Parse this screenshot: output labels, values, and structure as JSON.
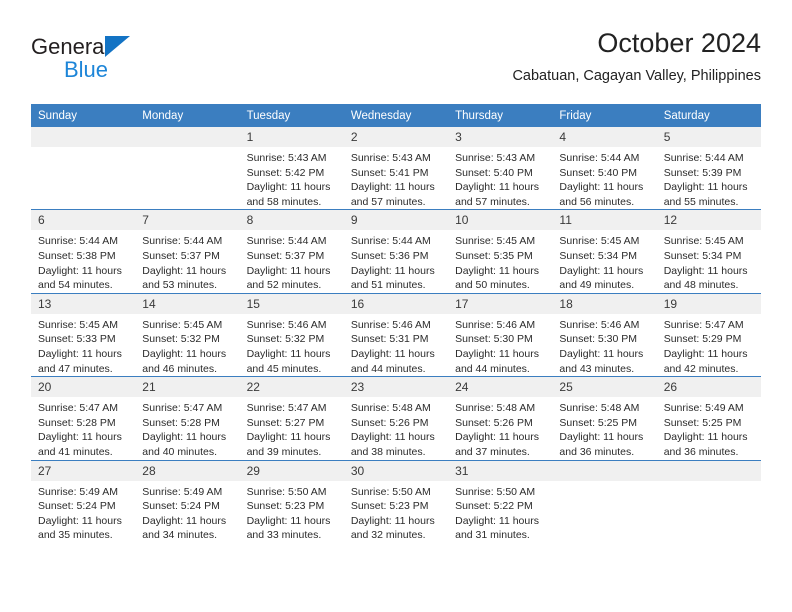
{
  "brand": {
    "name_part1": "General",
    "name_part2": "Blue",
    "triangle_color": "#1373c4",
    "blue_color": "#1d85d8"
  },
  "header": {
    "title": "October 2024",
    "location": "Cabatuan, Cagayan Valley, Philippines"
  },
  "theme": {
    "header_blue": "#3b7ec0",
    "daynum_bg": "#f0f0f0",
    "text": "#222222"
  },
  "weekday_headers": [
    "Sunday",
    "Monday",
    "Tuesday",
    "Wednesday",
    "Thursday",
    "Friday",
    "Saturday"
  ],
  "weeks": [
    [
      {
        "day": "",
        "empty": true
      },
      {
        "day": "",
        "empty": true
      },
      {
        "day": "1",
        "sunrise": "Sunrise: 5:43 AM",
        "sunset": "Sunset: 5:42 PM",
        "daylight_line1": "Daylight: 11 hours",
        "daylight_line2": "and 58 minutes."
      },
      {
        "day": "2",
        "sunrise": "Sunrise: 5:43 AM",
        "sunset": "Sunset: 5:41 PM",
        "daylight_line1": "Daylight: 11 hours",
        "daylight_line2": "and 57 minutes."
      },
      {
        "day": "3",
        "sunrise": "Sunrise: 5:43 AM",
        "sunset": "Sunset: 5:40 PM",
        "daylight_line1": "Daylight: 11 hours",
        "daylight_line2": "and 57 minutes."
      },
      {
        "day": "4",
        "sunrise": "Sunrise: 5:44 AM",
        "sunset": "Sunset: 5:40 PM",
        "daylight_line1": "Daylight: 11 hours",
        "daylight_line2": "and 56 minutes."
      },
      {
        "day": "5",
        "sunrise": "Sunrise: 5:44 AM",
        "sunset": "Sunset: 5:39 PM",
        "daylight_line1": "Daylight: 11 hours",
        "daylight_line2": "and 55 minutes."
      }
    ],
    [
      {
        "day": "6",
        "sunrise": "Sunrise: 5:44 AM",
        "sunset": "Sunset: 5:38 PM",
        "daylight_line1": "Daylight: 11 hours",
        "daylight_line2": "and 54 minutes."
      },
      {
        "day": "7",
        "sunrise": "Sunrise: 5:44 AM",
        "sunset": "Sunset: 5:37 PM",
        "daylight_line1": "Daylight: 11 hours",
        "daylight_line2": "and 53 minutes."
      },
      {
        "day": "8",
        "sunrise": "Sunrise: 5:44 AM",
        "sunset": "Sunset: 5:37 PM",
        "daylight_line1": "Daylight: 11 hours",
        "daylight_line2": "and 52 minutes."
      },
      {
        "day": "9",
        "sunrise": "Sunrise: 5:44 AM",
        "sunset": "Sunset: 5:36 PM",
        "daylight_line1": "Daylight: 11 hours",
        "daylight_line2": "and 51 minutes."
      },
      {
        "day": "10",
        "sunrise": "Sunrise: 5:45 AM",
        "sunset": "Sunset: 5:35 PM",
        "daylight_line1": "Daylight: 11 hours",
        "daylight_line2": "and 50 minutes."
      },
      {
        "day": "11",
        "sunrise": "Sunrise: 5:45 AM",
        "sunset": "Sunset: 5:34 PM",
        "daylight_line1": "Daylight: 11 hours",
        "daylight_line2": "and 49 minutes."
      },
      {
        "day": "12",
        "sunrise": "Sunrise: 5:45 AM",
        "sunset": "Sunset: 5:34 PM",
        "daylight_line1": "Daylight: 11 hours",
        "daylight_line2": "and 48 minutes."
      }
    ],
    [
      {
        "day": "13",
        "sunrise": "Sunrise: 5:45 AM",
        "sunset": "Sunset: 5:33 PM",
        "daylight_line1": "Daylight: 11 hours",
        "daylight_line2": "and 47 minutes."
      },
      {
        "day": "14",
        "sunrise": "Sunrise: 5:45 AM",
        "sunset": "Sunset: 5:32 PM",
        "daylight_line1": "Daylight: 11 hours",
        "daylight_line2": "and 46 minutes."
      },
      {
        "day": "15",
        "sunrise": "Sunrise: 5:46 AM",
        "sunset": "Sunset: 5:32 PM",
        "daylight_line1": "Daylight: 11 hours",
        "daylight_line2": "and 45 minutes."
      },
      {
        "day": "16",
        "sunrise": "Sunrise: 5:46 AM",
        "sunset": "Sunset: 5:31 PM",
        "daylight_line1": "Daylight: 11 hours",
        "daylight_line2": "and 44 minutes."
      },
      {
        "day": "17",
        "sunrise": "Sunrise: 5:46 AM",
        "sunset": "Sunset: 5:30 PM",
        "daylight_line1": "Daylight: 11 hours",
        "daylight_line2": "and 44 minutes."
      },
      {
        "day": "18",
        "sunrise": "Sunrise: 5:46 AM",
        "sunset": "Sunset: 5:30 PM",
        "daylight_line1": "Daylight: 11 hours",
        "daylight_line2": "and 43 minutes."
      },
      {
        "day": "19",
        "sunrise": "Sunrise: 5:47 AM",
        "sunset": "Sunset: 5:29 PM",
        "daylight_line1": "Daylight: 11 hours",
        "daylight_line2": "and 42 minutes."
      }
    ],
    [
      {
        "day": "20",
        "sunrise": "Sunrise: 5:47 AM",
        "sunset": "Sunset: 5:28 PM",
        "daylight_line1": "Daylight: 11 hours",
        "daylight_line2": "and 41 minutes."
      },
      {
        "day": "21",
        "sunrise": "Sunrise: 5:47 AM",
        "sunset": "Sunset: 5:28 PM",
        "daylight_line1": "Daylight: 11 hours",
        "daylight_line2": "and 40 minutes."
      },
      {
        "day": "22",
        "sunrise": "Sunrise: 5:47 AM",
        "sunset": "Sunset: 5:27 PM",
        "daylight_line1": "Daylight: 11 hours",
        "daylight_line2": "and 39 minutes."
      },
      {
        "day": "23",
        "sunrise": "Sunrise: 5:48 AM",
        "sunset": "Sunset: 5:26 PM",
        "daylight_line1": "Daylight: 11 hours",
        "daylight_line2": "and 38 minutes."
      },
      {
        "day": "24",
        "sunrise": "Sunrise: 5:48 AM",
        "sunset": "Sunset: 5:26 PM",
        "daylight_line1": "Daylight: 11 hours",
        "daylight_line2": "and 37 minutes."
      },
      {
        "day": "25",
        "sunrise": "Sunrise: 5:48 AM",
        "sunset": "Sunset: 5:25 PM",
        "daylight_line1": "Daylight: 11 hours",
        "daylight_line2": "and 36 minutes."
      },
      {
        "day": "26",
        "sunrise": "Sunrise: 5:49 AM",
        "sunset": "Sunset: 5:25 PM",
        "daylight_line1": "Daylight: 11 hours",
        "daylight_line2": "and 36 minutes."
      }
    ],
    [
      {
        "day": "27",
        "sunrise": "Sunrise: 5:49 AM",
        "sunset": "Sunset: 5:24 PM",
        "daylight_line1": "Daylight: 11 hours",
        "daylight_line2": "and 35 minutes."
      },
      {
        "day": "28",
        "sunrise": "Sunrise: 5:49 AM",
        "sunset": "Sunset: 5:24 PM",
        "daylight_line1": "Daylight: 11 hours",
        "daylight_line2": "and 34 minutes."
      },
      {
        "day": "29",
        "sunrise": "Sunrise: 5:50 AM",
        "sunset": "Sunset: 5:23 PM",
        "daylight_line1": "Daylight: 11 hours",
        "daylight_line2": "and 33 minutes."
      },
      {
        "day": "30",
        "sunrise": "Sunrise: 5:50 AM",
        "sunset": "Sunset: 5:23 PM",
        "daylight_line1": "Daylight: 11 hours",
        "daylight_line2": "and 32 minutes."
      },
      {
        "day": "31",
        "sunrise": "Sunrise: 5:50 AM",
        "sunset": "Sunset: 5:22 PM",
        "daylight_line1": "Daylight: 11 hours",
        "daylight_line2": "and 31 minutes."
      },
      {
        "day": "",
        "empty": true
      },
      {
        "day": "",
        "empty": true
      }
    ]
  ]
}
